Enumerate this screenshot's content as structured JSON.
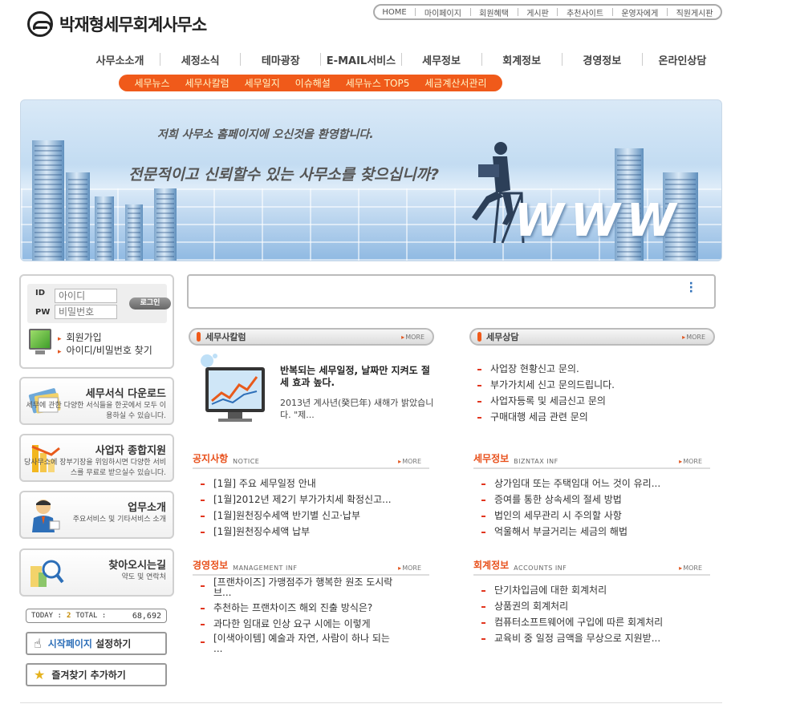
{
  "brand": {
    "name": "박재형세무회계사무소"
  },
  "util_nav": [
    "HOME",
    "마이페이지",
    "회원혜택",
    "게시판",
    "추천사이트",
    "운영자에게",
    "직원게시판"
  ],
  "main_nav": [
    "사무소소개",
    "세정소식",
    "테마광장",
    "E-MAIL서비스",
    "세무정보",
    "회계정보",
    "경영정보",
    "온라인상담"
  ],
  "sub_nav": [
    "세무뉴스",
    "세무사칼럼",
    "세무일지",
    "이슈해설",
    "세무뉴스 TOP5",
    "세금계산서관리"
  ],
  "banner": {
    "line1": "저희 사무소 홈페이지에 오신것을 환영합니다.",
    "line2": "전문적이고 신뢰할수 있는 사무소를 찾으십니까?",
    "www": "WWW"
  },
  "login": {
    "id_label": "ID",
    "pw_label": "PW",
    "id_placeholder": "아이디",
    "pw_placeholder": "비밀번호",
    "button": "로그인",
    "links": [
      "회원가입",
      "아이디/비밀번호 찾기"
    ]
  },
  "side_boxes": [
    {
      "title": "세무서식 다운로드",
      "desc": "세무에 관한 다양한 서식들을 한곳에서 모두 이용하실 수 있습니다."
    },
    {
      "title": "사업자 종합지원",
      "desc": "당사무소에 장부기장을 위임하시면 다양한 서비스를 무료로 받으실수 있습니다."
    },
    {
      "title": "업무소개",
      "desc": "주요서비스 및 기타서비스 소개"
    },
    {
      "title": "찾아오시는길",
      "desc": "약도 및 연락처"
    }
  ],
  "counter": {
    "today_label": "TODAY :",
    "today": "2",
    "total_label": "TOTAL :",
    "total": "68,692"
  },
  "start_page": {
    "highlight": "시작페이지",
    "rest": " 설정하기"
  },
  "favorites": "즐겨찾기 추가하기",
  "more_label": "MORE",
  "column": {
    "title": "세무사칼럼",
    "article_title": "반복되는 세무일정, 날짜만 지켜도 절세 효과 높다.",
    "article_desc": "2013년 계사년(癸巳年) 새해가 밝았습니다. \"제..."
  },
  "consult": {
    "title": "세무상담",
    "items": [
      "사업장 현황신고 문의.",
      "부가가치세 신고 문의드립니다.",
      "사업자등록 및 세금신고 문의",
      "구매대행 세금 관련 문의"
    ]
  },
  "notice": {
    "title": "공지사항",
    "sub": "NOTICE",
    "items": [
      "[1월] 주요 세무일정 안내",
      "[1월]2012년 제2기 부가가치세 확정신고...",
      "[1월]원천징수세액 반기별 신고·납부",
      "[1월]원천징수세액 납부"
    ]
  },
  "tax_info": {
    "title": "세무정보",
    "sub": "BIZNTAX INF",
    "items": [
      "상가임대 또는 주택임대 어느 것이 유리...",
      "증여를 통한 상속세의 절세 방법",
      "법인의 세무관리 시 주의할 사항",
      "억울해서 부글거리는 세금의 해법"
    ]
  },
  "mgmt_info": {
    "title": "경영정보",
    "sub": "MANAGEMENT INF",
    "items": [
      "[프랜차이즈] 가맹점주가 행복한 원조 도시락 브...",
      "추천하는 프랜차이즈 해외 진출 방식은?",
      "과다한 임대료 인상 요구 시에는 이렇게",
      "[이색아이템] 예술과 자연, 사람이 하나 되는 ..."
    ]
  },
  "acct_info": {
    "title": "회계정보",
    "sub": "ACCOUNTS INF",
    "items": [
      "단기차입금에 대한 회계처리",
      "상품권의 회계처리",
      "컴퓨터소프트웨어에 구입에 따른 회계처리",
      "교육비 중 일정 금액을 무상으로 지원받..."
    ]
  }
}
